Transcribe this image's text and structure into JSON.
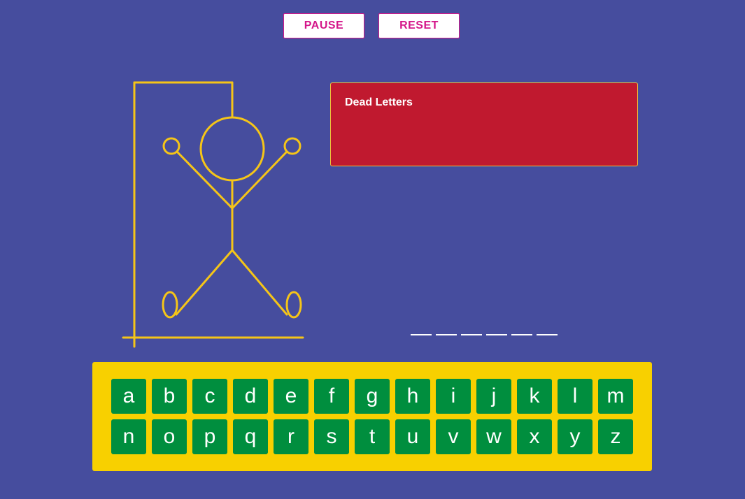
{
  "controls": {
    "pause_label": "PAUSE",
    "reset_label": "RESET"
  },
  "dead_letters": {
    "title": "Dead Letters",
    "letters": ""
  },
  "word": {
    "slots": [
      "",
      "",
      "",
      "",
      "",
      ""
    ]
  },
  "keyboard": {
    "row1": [
      "a",
      "b",
      "c",
      "d",
      "e",
      "f",
      "g",
      "h",
      "i",
      "j",
      "k",
      "l",
      "m"
    ],
    "row2": [
      "n",
      "o",
      "p",
      "q",
      "r",
      "s",
      "t",
      "u",
      "v",
      "w",
      "x",
      "y",
      "z"
    ]
  },
  "colors": {
    "background": "#464d9e",
    "accent_pink": "#d4178a",
    "gallows_yellow": "#f5c518",
    "dead_box_red": "#c0192f",
    "keyboard_yellow": "#f8d000",
    "key_green": "#008e3e"
  }
}
